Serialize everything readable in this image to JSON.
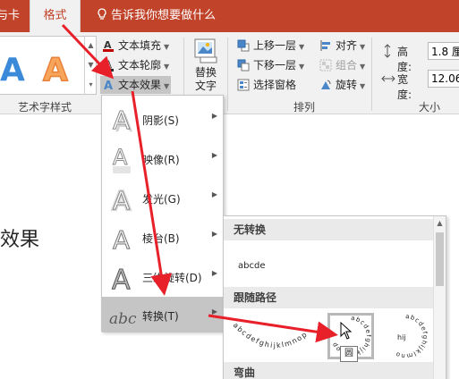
{
  "tabs": {
    "prev": "与卡",
    "active": "格式",
    "tell_me": "告诉我你想要做什么"
  },
  "wordart_group": {
    "label": "艺术字样式",
    "sample_blue": "A",
    "sample_orange": "A",
    "text_fill": "文本填充",
    "text_outline": "文本轮廓",
    "text_effects": "文本效果"
  },
  "alt_text": {
    "line1": "替换",
    "line2": "文字"
  },
  "arrange_group": {
    "label": "排列",
    "bring_forward": "上移一层",
    "send_backward": "下移一层",
    "selection_pane": "选择窗格",
    "align": "对齐",
    "group": "组合",
    "rotate": "旋转"
  },
  "size_group": {
    "label": "大小",
    "height_label": "高度:",
    "height_value": "1.8 厘",
    "width_label": "宽度:",
    "width_value": "12.06"
  },
  "slide": {
    "text_fragment": "效果"
  },
  "effects_menu": {
    "items": [
      {
        "label": "阴影(S)",
        "icon": "shadow-a-icon"
      },
      {
        "label": "映像(R)",
        "icon": "reflection-a-icon"
      },
      {
        "label": "发光(G)",
        "icon": "glow-a-icon"
      },
      {
        "label": "棱台(B)",
        "icon": "bevel-a-icon"
      },
      {
        "label": "三维旋转(D)",
        "icon": "3d-rotation-a-icon"
      },
      {
        "label": "转换(T)",
        "icon": "transform-abc-icon"
      }
    ]
  },
  "transform_menu": {
    "no_transform_header": "无转换",
    "no_transform_sample": "abcde",
    "follow_path_header": "跟随路径",
    "warp_header": "弯曲",
    "tooltip": "圆"
  },
  "colors": {
    "accent_red": "#c0432a",
    "ribbon_bg": "#f1f1f1",
    "highlight": "#c5c5c5",
    "annotation_arrow": "#e8202a"
  }
}
